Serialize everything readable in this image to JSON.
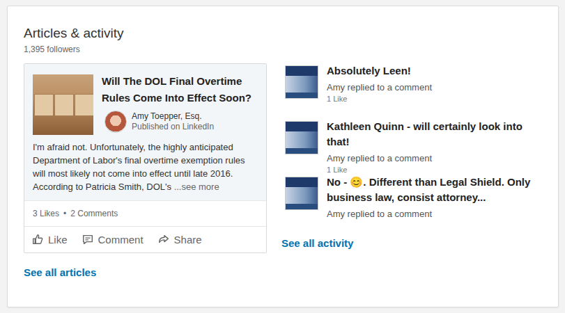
{
  "section": {
    "title": "Articles & activity",
    "followers": "1,395 followers"
  },
  "article": {
    "title": "Will The DOL Final Overtime Rules Come Into Effect Soon?",
    "author": "Amy Toepper, Esq.",
    "published": "Published on LinkedIn",
    "excerpt": "I'm afraid not. Unfortunately, the highly anticipated Department of Labor's final overtime exemption rules will most likely not come into effect until late 2016. According to Patricia Smith, DOL's",
    "see_more": "...see more",
    "likes": "3 Likes",
    "separator": "•",
    "comments": "2 Comments",
    "actions": [
      {
        "label": "Like",
        "icon": "like"
      },
      {
        "label": "Comment",
        "icon": "comment"
      },
      {
        "label": "Share",
        "icon": "share"
      }
    ]
  },
  "see_all_articles": "See all articles",
  "activity": [
    {
      "title": "Absolutely Leen!",
      "meta": "Amy replied to a comment",
      "likes": "1 Like"
    },
    {
      "title": "Kathleen Quinn - will certainly look into that!",
      "meta": "Amy replied to a comment",
      "likes": "1 Like"
    },
    {
      "title": "No - 😊. Different than Legal Shield. Only business law, consist attorney...",
      "meta": "Amy replied to a comment"
    }
  ],
  "see_all_activity": "See all activity"
}
